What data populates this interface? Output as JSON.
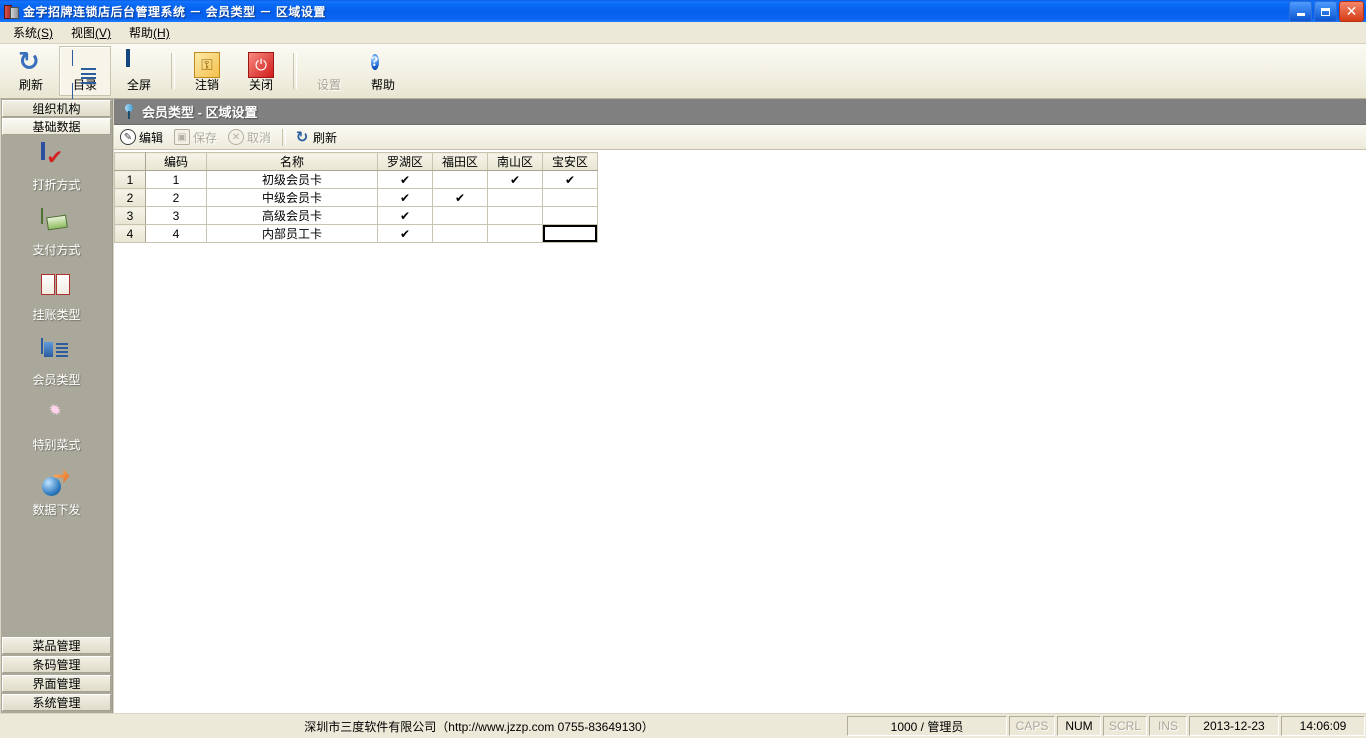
{
  "window": {
    "title": "金字招牌连锁店后台管理系统  －  会员类型  －  区域设置",
    "minimize_label": "最小化",
    "restore_label": "还原",
    "close_label": "关闭"
  },
  "menubar": [
    {
      "label": "系统",
      "accel": "(S)"
    },
    {
      "label": "视图",
      "accel": "(V)"
    },
    {
      "label": "帮助",
      "accel": "(H)"
    }
  ],
  "toolbar": [
    {
      "label": "刷新",
      "icon": "refresh-icon",
      "enabled": true,
      "selected": false
    },
    {
      "label": "目录",
      "icon": "list-icon",
      "enabled": true,
      "selected": true
    },
    {
      "label": "全屏",
      "icon": "screen-icon",
      "enabled": true,
      "selected": false
    },
    {
      "label": "注销",
      "icon": "key-icon",
      "enabled": true,
      "selected": false
    },
    {
      "label": "关闭",
      "icon": "power-icon",
      "enabled": true,
      "selected": false
    },
    {
      "label": "设置",
      "icon": "globe-icon",
      "enabled": false,
      "selected": false
    },
    {
      "label": "帮助",
      "icon": "help-icon",
      "enabled": true,
      "selected": false
    }
  ],
  "sidebar": {
    "top_headers": [
      {
        "label": "组织机构",
        "active": false
      },
      {
        "label": "基础数据",
        "active": true
      }
    ],
    "items": [
      {
        "label": "打折方式",
        "icon": "clipboard-check-icon"
      },
      {
        "label": "支付方式",
        "icon": "money-icon"
      },
      {
        "label": "挂账类型",
        "icon": "book-icon"
      },
      {
        "label": "会员类型",
        "icon": "member-card-icon"
      },
      {
        "label": "特别菜式",
        "icon": "star-dish-icon"
      },
      {
        "label": "数据下发",
        "icon": "data-download-icon"
      }
    ],
    "bottom_headers": [
      {
        "label": "菜品管理"
      },
      {
        "label": "条码管理"
      },
      {
        "label": "界面管理"
      },
      {
        "label": "系统管理"
      }
    ]
  },
  "content": {
    "header_title": "会员类型 - 区域设置",
    "header_icon": "pin-icon",
    "grid_toolbar": [
      {
        "label": "编辑",
        "icon": "pencil-icon",
        "enabled": true
      },
      {
        "label": "保存",
        "icon": "save-icon",
        "enabled": false
      },
      {
        "label": "取消",
        "icon": "cancel-icon",
        "enabled": false
      },
      {
        "label": "刷新",
        "icon": "refresh-icon",
        "enabled": true
      }
    ],
    "grid": {
      "columns": [
        "",
        "编码",
        "名称",
        "罗湖区",
        "福田区",
        "南山区",
        "宝安区"
      ],
      "rows": [
        {
          "num": "1",
          "code": "1",
          "name": "初级会员卡",
          "checks": [
            "✔",
            "",
            "✔",
            "✔"
          ]
        },
        {
          "num": "2",
          "code": "2",
          "name": "中级会员卡",
          "checks": [
            "✔",
            "✔",
            "",
            ""
          ]
        },
        {
          "num": "3",
          "code": "3",
          "name": "高级会员卡",
          "checks": [
            "✔",
            "",
            "",
            ""
          ]
        },
        {
          "num": "4",
          "code": "4",
          "name": "内部员工卡",
          "checks": [
            "✔",
            "",
            "",
            ""
          ]
        }
      ],
      "selected_cell": {
        "row": 3,
        "col": 3
      }
    }
  },
  "statusbar": {
    "company": "深圳市三度软件有限公司（http://www.jzzp.com  0755-83649130）",
    "user": "1000 / 管理员",
    "indicators": [
      {
        "label": "CAPS",
        "active": false
      },
      {
        "label": "NUM",
        "active": true
      },
      {
        "label": "SCRL",
        "active": false
      },
      {
        "label": "INS",
        "active": false
      }
    ],
    "date": "2013-12-23",
    "time": "14:06:09"
  }
}
